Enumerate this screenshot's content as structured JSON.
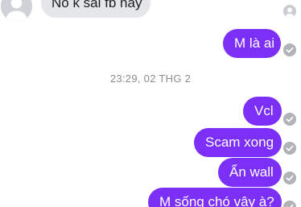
{
  "received_message": {
    "text": "Nó k sài fb nay"
  },
  "sent_messages": [
    {
      "text": "M là ai"
    },
    {
      "text": "Vcl"
    },
    {
      "text": "Scam xong"
    },
    {
      "text": "Ẩn wall"
    },
    {
      "text": "M sống chó vậy à?"
    }
  ],
  "timestamp": "23:29, 02 THG 2",
  "colors": {
    "sent_bubble": "#7b2ff7",
    "received_bubble": "#e4e6ea",
    "timestamp_text": "#8a8d91",
    "read_check": "#b0b3b8"
  },
  "icons": {
    "avatar": "default-avatar-icon",
    "seen_status": "user-avatar-small-icon",
    "delivered": "check-circle-icon"
  }
}
